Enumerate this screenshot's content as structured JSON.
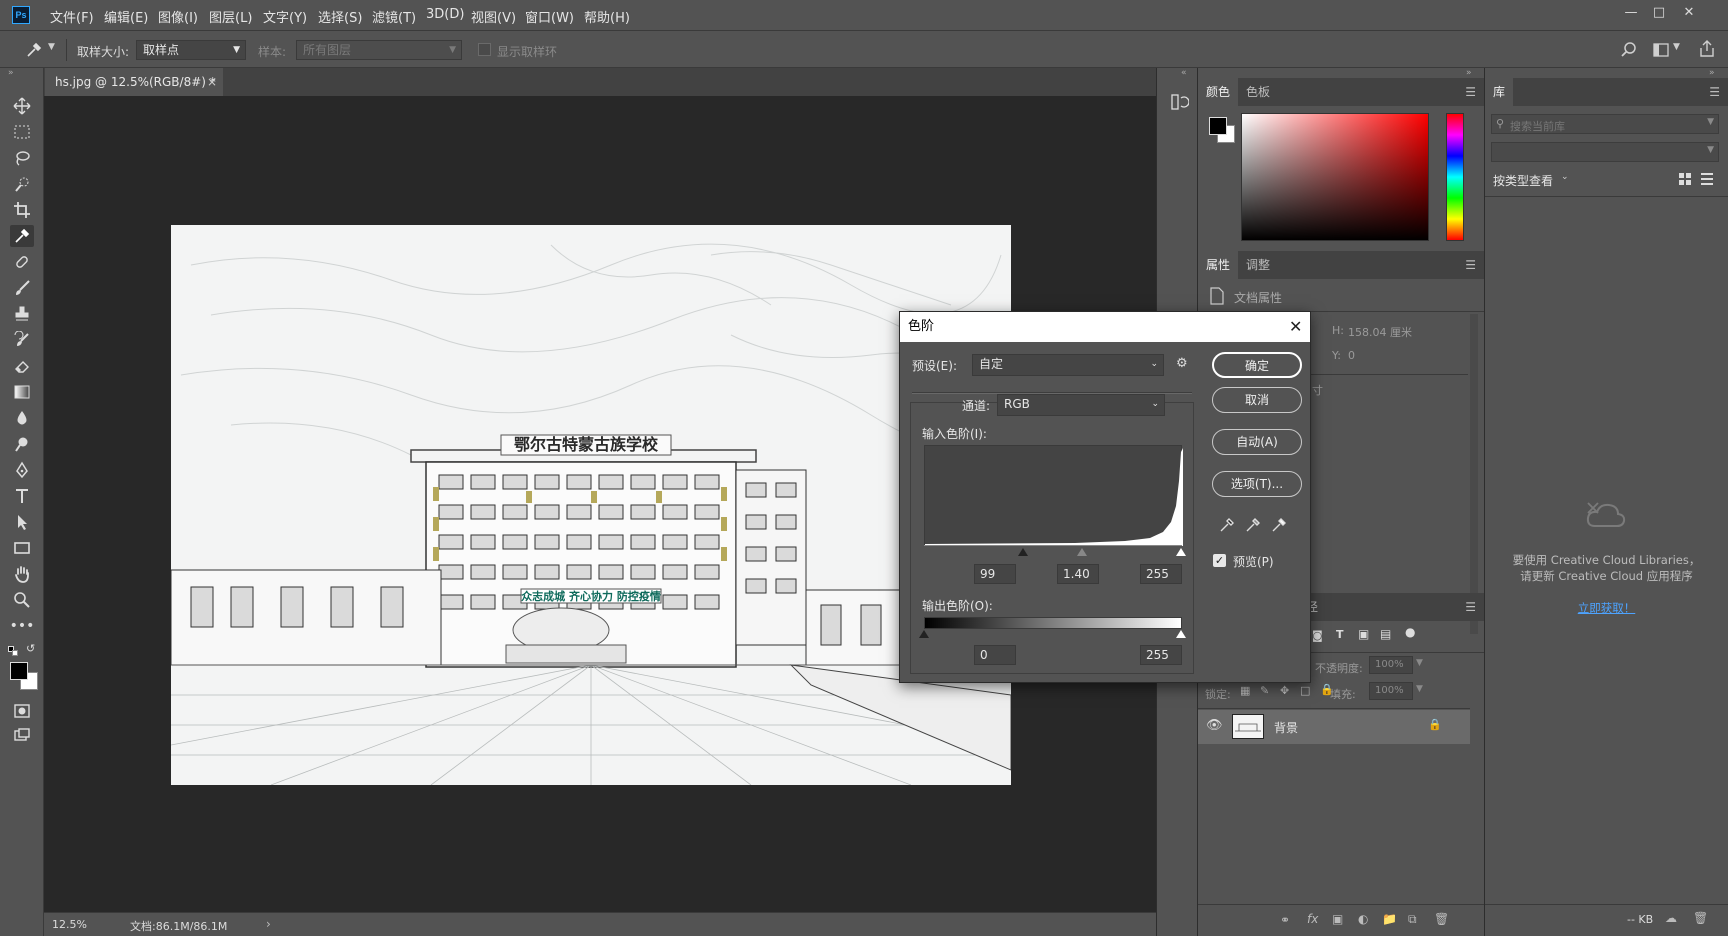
{
  "app": {
    "logo": "Ps"
  },
  "menu": [
    "文件(F)",
    "编辑(E)",
    "图像(I)",
    "图层(L)",
    "文字(Y)",
    "选择(S)",
    "滤镜(T)",
    "3D(D)",
    "视图(V)",
    "窗口(W)",
    "帮助(H)"
  ],
  "options_bar": {
    "sample_size_label": "取样大小:",
    "sample_size_value": "取样点",
    "sample_label": "样本:",
    "sample_value": "所有图层",
    "show_ring_label": "显示取样环"
  },
  "document": {
    "tab_title": "hs.jpg @ 12.5%(RGB/8#) *",
    "photo_sign": "众志成城  齐心协力  防控疫情",
    "photo_roof_text": "鄂尔古特蒙古族学校"
  },
  "status": {
    "zoom": "12.5%",
    "doc_info": "文档:86.1M/86.1M"
  },
  "color_panel": {
    "tabs": [
      "颜色",
      "色板"
    ],
    "active_tab": "颜色"
  },
  "properties_panel": {
    "tabs": [
      "属性",
      "调整"
    ],
    "section": "文档属性",
    "h_label": "H:",
    "h_value": "158.04 厘米",
    "y_label": "Y:",
    "y_value": "0",
    "partial_text": "寸"
  },
  "layers_panel": {
    "tab_partial": "径",
    "opacity_label": "不透明度:",
    "opacity_value": "100%",
    "lock_label": "锁定:",
    "fill_label": "填充:",
    "fill_value": "100%",
    "layer_name": "背景"
  },
  "library_panel": {
    "title": "库",
    "search_placeholder": "搜索当前库",
    "view_label": "按类型查看",
    "message_line1": "要使用 Creative Cloud Libraries，",
    "message_line2": "请更新 Creative Cloud 应用程序",
    "link": "立即获取！",
    "footer_kb": "-- KB"
  },
  "levels_dialog": {
    "title": "色阶",
    "preset_label": "预设(E):",
    "preset_value": "自定",
    "channel_label": "通道:",
    "channel_value": "RGB",
    "input_label": "输入色阶(I):",
    "input_black": "99",
    "input_gamma": "1.40",
    "input_white": "255",
    "output_label": "输出色阶(O):",
    "output_black": "0",
    "output_white": "255",
    "buttons": {
      "ok": "确定",
      "cancel": "取消",
      "auto": "自动(A)",
      "options": "选项(T)..."
    },
    "preview_label": "预览(P)",
    "preview_checked": true
  },
  "colors": {
    "foreground": "#000000",
    "background": "#ffffff",
    "accent_link": "#4da3ff",
    "dialog_title_bg": "#ffffff"
  }
}
